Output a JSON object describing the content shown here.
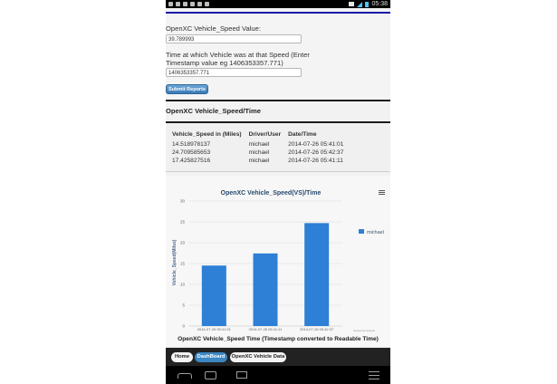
{
  "status_bar": {
    "time": "05:38"
  },
  "form": {
    "speed_label": "OpenXC Vehicle_Speed Value:",
    "speed_value": "39.789993",
    "time_label_line1": "Time at which Vehicle was at that Speed (Enter",
    "time_label_line2": "Timestamp value eg 1406353357.771)",
    "time_value": "1406353357.771",
    "submit_label": "Submit Reports"
  },
  "section_title": "OpenXC Vehicle_Speed/Time",
  "table": {
    "headers": [
      "Vehicle_Speed in (Miles)",
      "Driver/User",
      "Date/Time"
    ],
    "rows": [
      [
        "14.518978137",
        "michael",
        "2014-07-26 05:41:01"
      ],
      [
        "24.709585653",
        "michael",
        "2014-07-26 05:42:37"
      ],
      [
        "17.425827516",
        "michael",
        "2014-07-26 05:41:11"
      ]
    ]
  },
  "chart_data": {
    "type": "bar",
    "title": "OpenXC Vehicle_Speed(VS)/Time",
    "xlabel": "OpenXC Vehicle_Speed Time (Timestamp converted to Readable Time)",
    "ylabel": "Vehicle_Speed(Miles)",
    "categories": [
      "2014-07-26 05:41:01",
      "2014-07-26 05:41:11",
      "2014-07-26 05:42:37"
    ],
    "series": [
      {
        "name": "michael",
        "values": [
          14.52,
          17.43,
          24.71
        ]
      }
    ],
    "ylim": [
      0,
      30
    ],
    "yticks": [
      0,
      5,
      10,
      15,
      20,
      25,
      30
    ],
    "grid": true,
    "legend": "right",
    "credit": "Javascript Graphs",
    "bar_color": "#2e7fd6"
  },
  "nav": {
    "home": "Home",
    "dashboard": "DashBoard",
    "data": "OpenXC Vehicle Data"
  }
}
